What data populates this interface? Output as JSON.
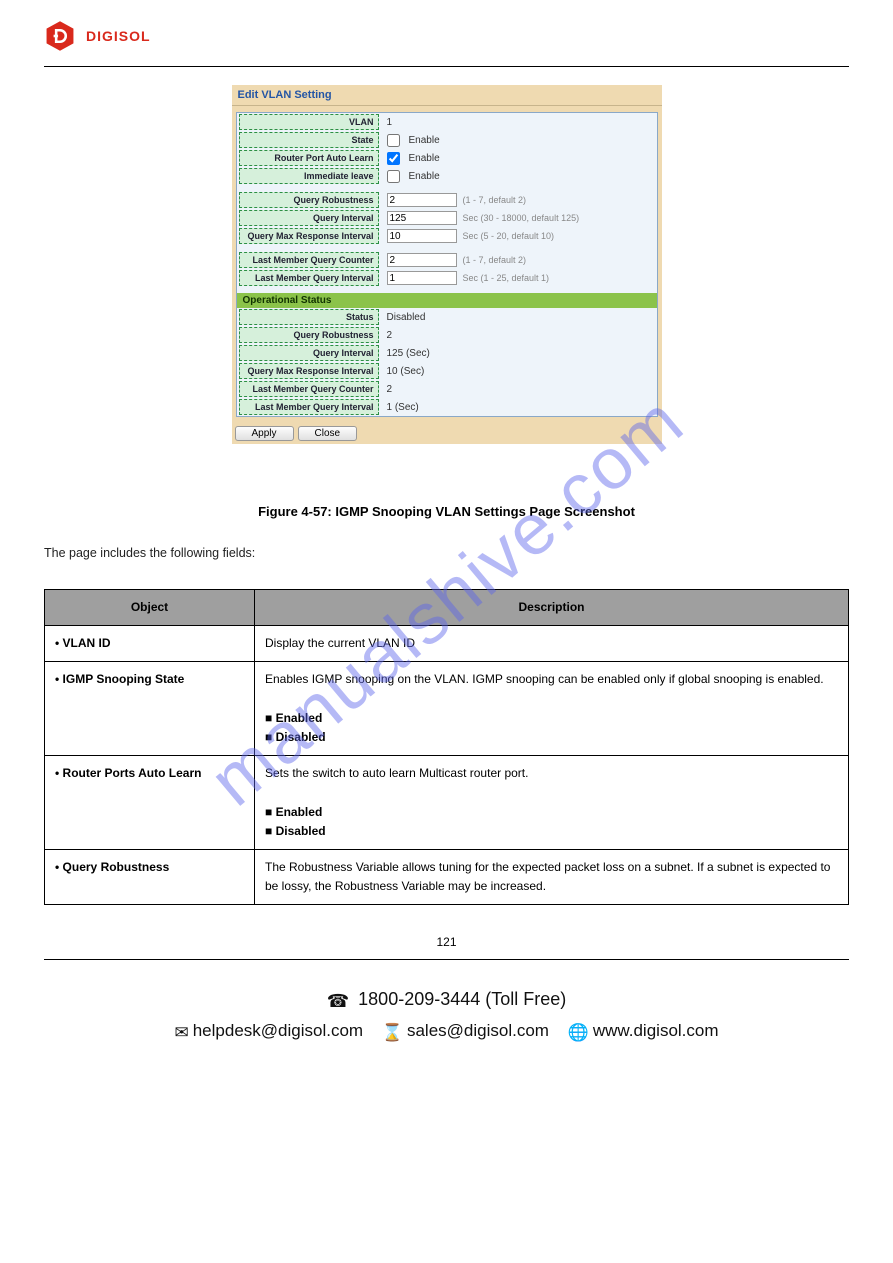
{
  "brand": "DIGISOL",
  "panel": {
    "title": "Edit VLAN Setting",
    "rows": {
      "vlan": {
        "label": "VLAN",
        "value": "1"
      },
      "state": {
        "label": "State",
        "cb_label": "Enable",
        "checked": false
      },
      "rpal": {
        "label": "Router Port Auto Learn",
        "cb_label": "Enable",
        "checked": true
      },
      "imm": {
        "label": "Immediate leave",
        "cb_label": "Enable",
        "checked": false
      },
      "qr": {
        "label": "Query Robustness",
        "value": "2",
        "hint": "(1 - 7, default 2)"
      },
      "qi": {
        "label": "Query Interval",
        "value": "125",
        "hint": "Sec (30 - 18000, default 125)"
      },
      "qmri": {
        "label": "Query Max Response Interval",
        "value": "10",
        "hint": "Sec (5 - 20, default 10)"
      },
      "lmqc": {
        "label": "Last Member Query Counter",
        "value": "2",
        "hint": "(1 - 7, default 2)"
      },
      "lmqi": {
        "label": "Last Member Query Interval",
        "value": "1",
        "hint": "Sec (1 - 25, default 1)"
      }
    },
    "op_header": "Operational Status",
    "op": {
      "status": {
        "label": "Status",
        "value": "Disabled"
      },
      "qr": {
        "label": "Query Robustness",
        "value": "2"
      },
      "qi": {
        "label": "Query Interval",
        "value": "125 (Sec)"
      },
      "qmri": {
        "label": "Query Max Response Interval",
        "value": "10 (Sec)"
      },
      "lmqc": {
        "label": "Last Member Query Counter",
        "value": "2"
      },
      "lmqi": {
        "label": "Last Member Query Interval",
        "value": "1 (Sec)"
      }
    },
    "apply": "Apply",
    "close": "Close"
  },
  "figcap": "Figure 4-57: IGMP Snooping VLAN Settings Page Screenshot",
  "para": "The page includes the following fields:",
  "table": {
    "h1": "Object",
    "h2": "Description",
    "r1o": "VLAN ID",
    "r1d": "Display the current VLAN ID",
    "r2o": "IGMP Snooping State",
    "r2d": "Enables IGMP snooping on the VLAN. IGMP snooping can be enabled only if global snooping is enabled.",
    "r2d_bullets": [
      "Enabled",
      "Disabled"
    ],
    "r3o": "Router Ports Auto Learn",
    "r3d": "Sets the switch to auto learn Multicast router port.",
    "r3d_bullets": [
      "Enabled",
      "Disabled"
    ],
    "r4o": "Query Robustness",
    "r4d": "The Robustness Variable allows tuning for the expected packet loss on a subnet. If a subnet is expected to be lossy, the Robustness Variable may be increased."
  },
  "page_number": "121",
  "footer": {
    "phone": "1800-209-3444 (Toll Free)",
    "help": "helpdesk@digisol.com",
    "sales": "sales@digisol.com",
    "web": "www.digisol.com"
  },
  "watermark": "manualshive.com"
}
